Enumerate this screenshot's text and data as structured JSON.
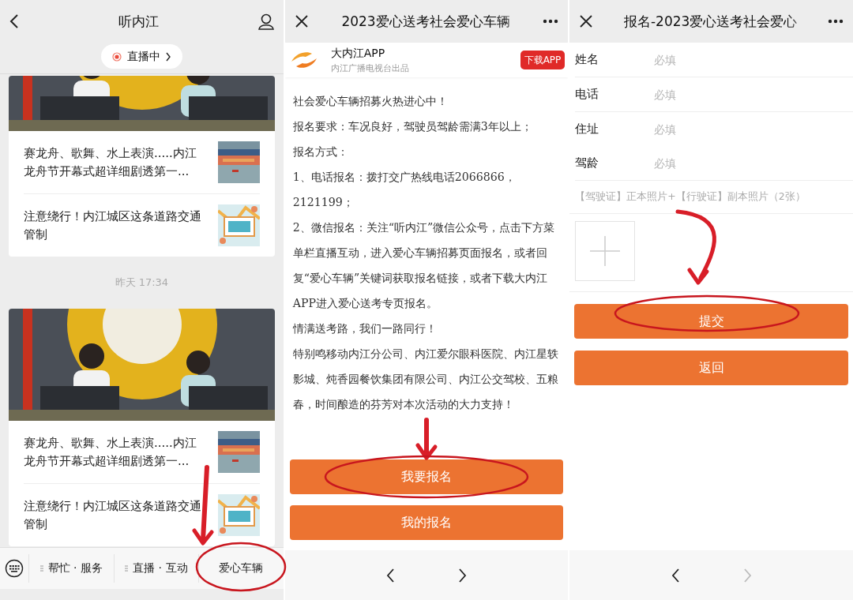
{
  "panels": [
    {
      "kind": "channel",
      "title": "听内江",
      "live_badge": "直播中",
      "feed": [
        {
          "kind": "card",
          "items": [
            {
              "title": "赛龙舟、歌舞、水上表演.....内江龙舟节开幕式超详细剧透第一..."
            },
            {
              "title": "注意绕行！内江城区这条道路交通管制"
            }
          ]
        },
        {
          "kind": "time",
          "text": "昨天 17:34"
        },
        {
          "kind": "card",
          "items": [
            {
              "title": "赛龙舟、歌舞、水上表演.....内江龙舟节开幕式超详细剧透第一..."
            },
            {
              "title": "注意绕行！内江城区这条道路交通管制"
            }
          ]
        }
      ],
      "menu": [
        {
          "label": "帮忙 · 服务",
          "submenu": true
        },
        {
          "label": "直播 · 互动",
          "submenu": true
        },
        {
          "label": "爱心车辆",
          "submenu": false
        }
      ]
    },
    {
      "kind": "article",
      "title": "2023爱心送考社会爱心车辆",
      "promo": {
        "name": "大内江APP",
        "subtitle": "内江广播电视台出品",
        "button": "下载APP"
      },
      "paragraphs": [
        "社会爱心车辆招募火热进心中！",
        "报名要求：车况良好，驾驶员驾龄需满3年以上；",
        "报名方式：",
        "1、电话报名：拨打交广热线电话2066866，2121199；",
        "2、微信报名：关注“听内江”微信公众号，点击下方菜单栏直播互动，进入爱心车辆招募页面报名，或者回复“爱心车辆”关键词获取报名链接，或者下载大内江APP进入爱心送考专页报名。",
        "情满送考路，我们一路同行！",
        "特别鸣移动内江分公司、内江爱尔眼科医院、内江星轶影城、炖香园餐饮集团有限公司、内江公交驾校、五粮春，时间酿造的芬芳对本次活动的大力支持！"
      ],
      "buttons": [
        "我要报名",
        "我的报名"
      ],
      "nav": {
        "back_disabled": false,
        "forward_disabled": false
      }
    },
    {
      "kind": "form",
      "title": "报名-2023爱心送考社会爱心",
      "fields": [
        {
          "label": "姓名",
          "placeholder": "必填"
        },
        {
          "label": "电话",
          "placeholder": "必填"
        },
        {
          "label": "住址",
          "placeholder": "必填"
        },
        {
          "label": "驾龄",
          "placeholder": "必填"
        }
      ],
      "hint": "【驾驶证】正本照片+【行驶证】副本照片（2张）",
      "buttons": [
        "提交",
        "返回"
      ],
      "nav": {
        "back_disabled": false,
        "forward_disabled": true
      }
    }
  ],
  "annotations": [
    {
      "kind": "arrow"
    },
    {
      "kind": "circle"
    },
    {
      "kind": "arrow"
    },
    {
      "kind": "circle"
    },
    {
      "kind": "curl-arrow"
    },
    {
      "kind": "circle"
    }
  ]
}
